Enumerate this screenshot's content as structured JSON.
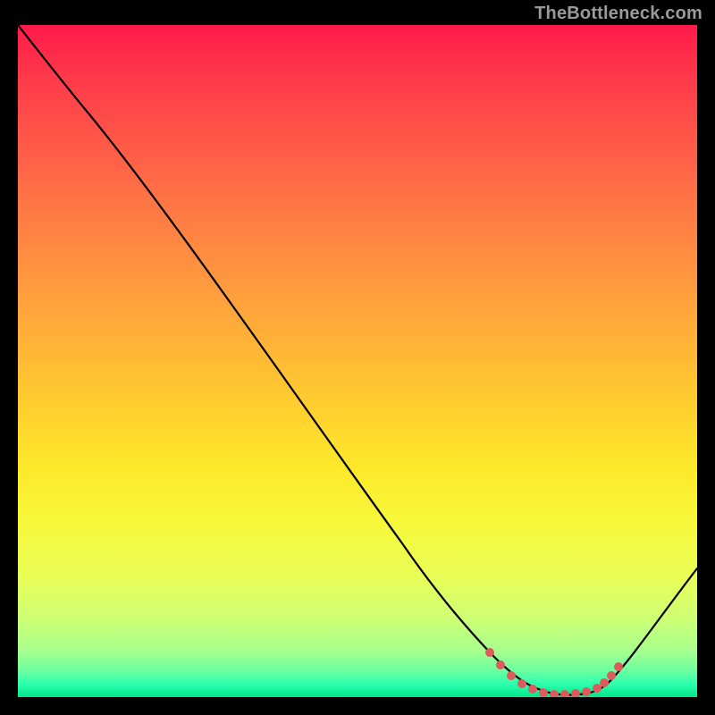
{
  "watermark": "TheBottleneck.com",
  "colors": {
    "frame": "#000000",
    "curve": "#000000",
    "dots": "#de5a5b",
    "gradient_top": "#ff1a4b",
    "gradient_bottom": "#00e789"
  },
  "chart_data": {
    "type": "line",
    "title": "",
    "xlabel": "",
    "ylabel": "",
    "xlim": [
      0,
      100
    ],
    "ylim": [
      0,
      100
    ],
    "x": [
      0,
      5,
      10,
      15,
      20,
      25,
      30,
      35,
      40,
      45,
      50,
      55,
      60,
      65,
      70,
      72,
      75,
      78,
      80,
      82,
      84,
      86,
      88,
      90,
      95,
      100
    ],
    "values": [
      100,
      94,
      87,
      80,
      73,
      66,
      59,
      52,
      45,
      38,
      31,
      24,
      17,
      11,
      6,
      4,
      2.2,
      1.2,
      0.6,
      0.4,
      0.4,
      0.7,
      1.5,
      3,
      9,
      18
    ],
    "highlight_points": {
      "x": [
        70,
        72,
        74,
        76,
        78,
        80,
        82,
        84,
        86,
        87,
        88,
        89
      ],
      "values": [
        6,
        4,
        2.8,
        1.8,
        1.2,
        0.6,
        0.4,
        0.4,
        0.7,
        1.2,
        1.5,
        2.2
      ]
    },
    "note": "Curve depicts a bottleneck-style mismatch percentage falling from ~100 at the left to a minimum near x≈82 then rising again toward the right."
  }
}
